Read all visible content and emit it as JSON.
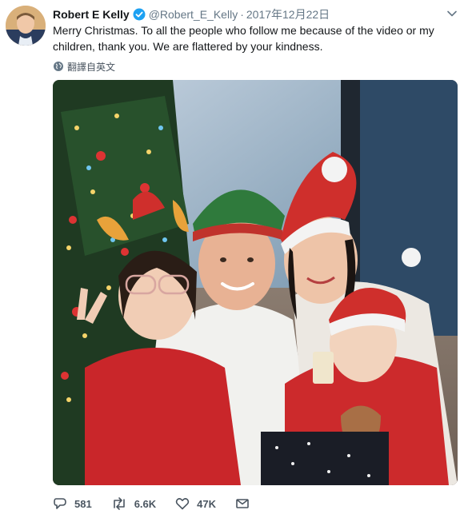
{
  "author": {
    "display_name": "Robert E Kelly",
    "handle": "@Robert_E_Kelly",
    "date": "2017年12月22日",
    "separator": "·"
  },
  "tweet": {
    "text": "Merry Christmas. To all the people who follow me because of the video or my children, thank you. We are flattered by your kindness."
  },
  "translate": {
    "label": "翻譯自英文"
  },
  "actions": {
    "replies": "581",
    "retweets": "6.6K",
    "likes": "47K"
  },
  "icons": {
    "verified": "verified-badge-icon",
    "caret": "chevron-down-icon",
    "globe": "globe-icon",
    "reply": "reply-icon",
    "retweet": "retweet-icon",
    "like": "heart-icon",
    "message": "envelope-icon"
  },
  "colors": {
    "accent": "#1da1f2",
    "muted": "#657786"
  }
}
